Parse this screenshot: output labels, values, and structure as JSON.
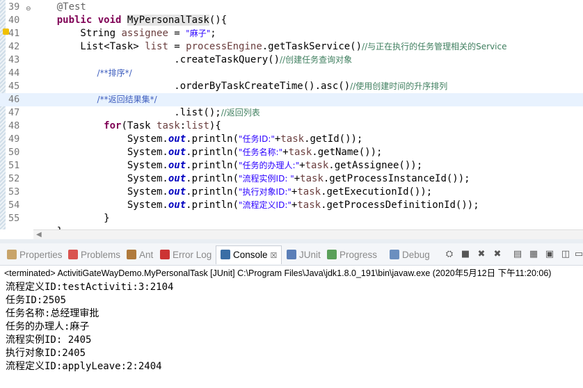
{
  "editor": {
    "lines": [
      {
        "no": "39",
        "parts": [
          [
            "ann",
            "    @Test"
          ]
        ]
      },
      {
        "no": "40",
        "parts": [
          [
            "kw",
            "    public void "
          ],
          [
            "meth hl-name",
            "MyPersonalTask"
          ],
          [
            "meth",
            "(){"
          ]
        ]
      },
      {
        "no": "41",
        "parts": [
          [
            "meth",
            "        String "
          ],
          [
            "var",
            "assignee"
          ],
          [
            "meth",
            " = "
          ],
          [
            "str",
            "\"麻子\""
          ],
          [
            "meth",
            ";"
          ]
        ]
      },
      {
        "no": "42",
        "parts": [
          [
            "meth",
            "        List<Task> "
          ],
          [
            "var",
            "list"
          ],
          [
            "meth",
            " = "
          ],
          [
            "var",
            "processEngine"
          ],
          [
            "meth",
            ".getTaskService()"
          ],
          [
            "cm",
            "//与正在执行的任务管理相关的Service"
          ]
        ]
      },
      {
        "no": "43",
        "parts": [
          [
            "meth",
            "                        .createTaskQuery()"
          ],
          [
            "cm",
            "//创建任务查询对象"
          ]
        ]
      },
      {
        "no": "44",
        "parts": [
          [
            "jd",
            "                        /**排序*/"
          ]
        ]
      },
      {
        "no": "45",
        "parts": [
          [
            "meth",
            "                        .orderByTaskCreateTime().asc()"
          ],
          [
            "cm",
            "//使用创建时间的升序排列"
          ]
        ]
      },
      {
        "no": "46",
        "parts": [
          [
            "jd",
            "                        /**返回结果集*/"
          ]
        ]
      },
      {
        "no": "47",
        "parts": [
          [
            "meth",
            "                        .list();"
          ],
          [
            "cm",
            "//返回列表"
          ]
        ]
      },
      {
        "no": "48",
        "parts": [
          [
            "kw",
            "            for"
          ],
          [
            "meth",
            "(Task "
          ],
          [
            "var",
            "task"
          ],
          [
            "meth",
            ":"
          ],
          [
            "var",
            "list"
          ],
          [
            "meth",
            "){"
          ]
        ]
      },
      {
        "no": "49",
        "parts": [
          [
            "meth",
            "                System."
          ],
          [
            "fld",
            "out"
          ],
          [
            "meth",
            ".println("
          ],
          [
            "str",
            "\"任务ID:\""
          ],
          [
            "meth",
            "+"
          ],
          [
            "var",
            "task"
          ],
          [
            "meth",
            ".getId());"
          ]
        ]
      },
      {
        "no": "50",
        "parts": [
          [
            "meth",
            "                System."
          ],
          [
            "fld",
            "out"
          ],
          [
            "meth",
            ".println("
          ],
          [
            "str",
            "\"任务名称:\""
          ],
          [
            "meth",
            "+"
          ],
          [
            "var",
            "task"
          ],
          [
            "meth",
            ".getName());"
          ]
        ]
      },
      {
        "no": "51",
        "parts": [
          [
            "meth",
            "                System."
          ],
          [
            "fld",
            "out"
          ],
          [
            "meth",
            ".println("
          ],
          [
            "str",
            "\"任务的办理人:\""
          ],
          [
            "meth",
            "+"
          ],
          [
            "var",
            "task"
          ],
          [
            "meth",
            ".getAssignee());"
          ]
        ]
      },
      {
        "no": "52",
        "parts": [
          [
            "meth",
            "                System."
          ],
          [
            "fld",
            "out"
          ],
          [
            "meth",
            ".println("
          ],
          [
            "str",
            "\"流程实例ID: \""
          ],
          [
            "meth",
            "+"
          ],
          [
            "var",
            "task"
          ],
          [
            "meth",
            ".getProcessInstanceId());"
          ]
        ]
      },
      {
        "no": "53",
        "parts": [
          [
            "meth",
            "                System."
          ],
          [
            "fld",
            "out"
          ],
          [
            "meth",
            ".println("
          ],
          [
            "str",
            "\"执行对象ID:\""
          ],
          [
            "meth",
            "+"
          ],
          [
            "var",
            "task"
          ],
          [
            "meth",
            ".getExecutionId());"
          ]
        ]
      },
      {
        "no": "54",
        "parts": [
          [
            "meth",
            "                System."
          ],
          [
            "fld",
            "out"
          ],
          [
            "meth",
            ".println("
          ],
          [
            "str",
            "\"流程定义ID:\""
          ],
          [
            "meth",
            "+"
          ],
          [
            "var",
            "task"
          ],
          [
            "meth",
            ".getProcessDefinitionId());"
          ]
        ]
      },
      {
        "no": "55",
        "parts": [
          [
            "meth",
            "            }"
          ]
        ]
      },
      {
        "no": "",
        "parts": [
          [
            "meth",
            "    }"
          ]
        ]
      }
    ]
  },
  "views": {
    "tabs": [
      {
        "label": "Properties",
        "icon": "properties-icon",
        "color": "#c8a46a"
      },
      {
        "label": "Problems",
        "icon": "problems-icon",
        "color": "#d9534f"
      },
      {
        "label": "Ant",
        "icon": "ant-icon",
        "color": "#b07a3c"
      },
      {
        "label": "Error Log",
        "icon": "error-log-icon",
        "color": "#cc3333"
      }
    ],
    "active_tab": "Console",
    "active_close": "☒",
    "tabs_after": [
      {
        "label": "JUnit",
        "icon": "junit-icon",
        "color": "#5b7fb8"
      },
      {
        "label": "Progress",
        "icon": "progress-icon",
        "color": "#5aa05a"
      },
      {
        "label": "Debug",
        "icon": "debug-icon",
        "color": "#6b8fbf"
      }
    ]
  },
  "console": {
    "terminated": "<terminated> ActivitiGateWayDemo.MyPersonalTask [JUnit] C:\\Program Files\\Java\\jdk1.8.0_191\\bin\\javaw.exe (2020年5月12日 下午11:20:06)",
    "output": [
      "流程定义ID:testActiviti:3:2104",
      "任务ID:2505",
      "任务名称:总经理审批",
      "任务的办理人:麻子",
      "流程实例ID: 2405",
      "执行对象ID:2405",
      "流程定义ID:applyLeave:2:2404"
    ]
  }
}
